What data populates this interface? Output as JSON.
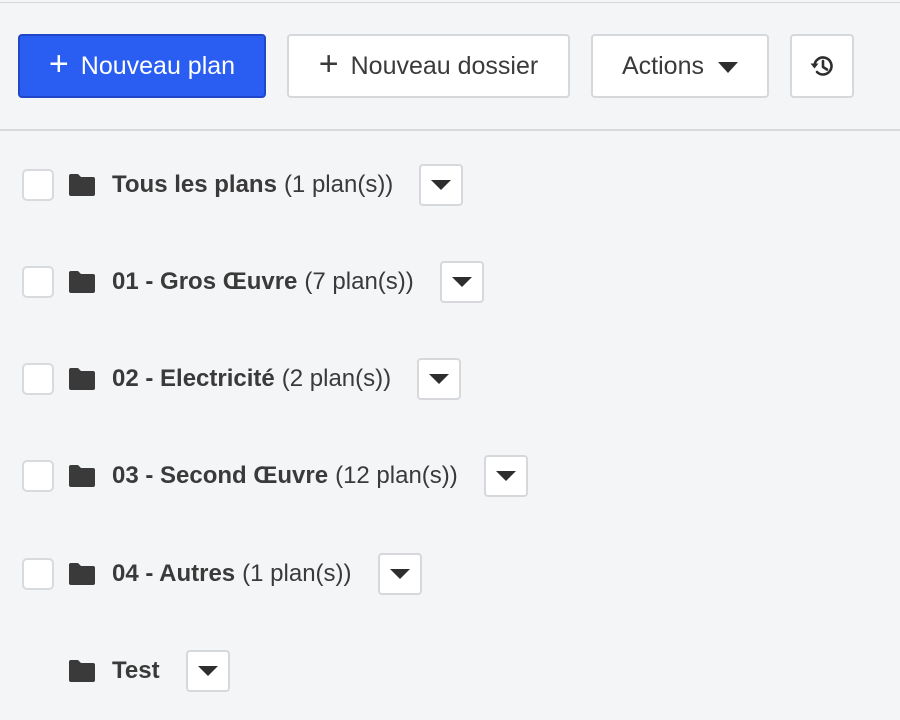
{
  "toolbar": {
    "new_plan_label": "Nouveau plan",
    "new_folder_label": "Nouveau dossier",
    "actions_label": "Actions",
    "history_icon": "history-icon",
    "primary_color": "#2a5ef2"
  },
  "folders": [
    {
      "name": "Tous les plans",
      "count": "(1 plan(s))"
    },
    {
      "name": "01 - Gros Œuvre",
      "count": "(7 plan(s))"
    },
    {
      "name": "02 - Electricité",
      "count": "(2 plan(s))"
    },
    {
      "name": "03 - Second Œuvre",
      "count": "(12 plan(s))"
    },
    {
      "name": "04 - Autres",
      "count": "(1 plan(s))"
    },
    {
      "name": "Test",
      "count": ""
    }
  ]
}
